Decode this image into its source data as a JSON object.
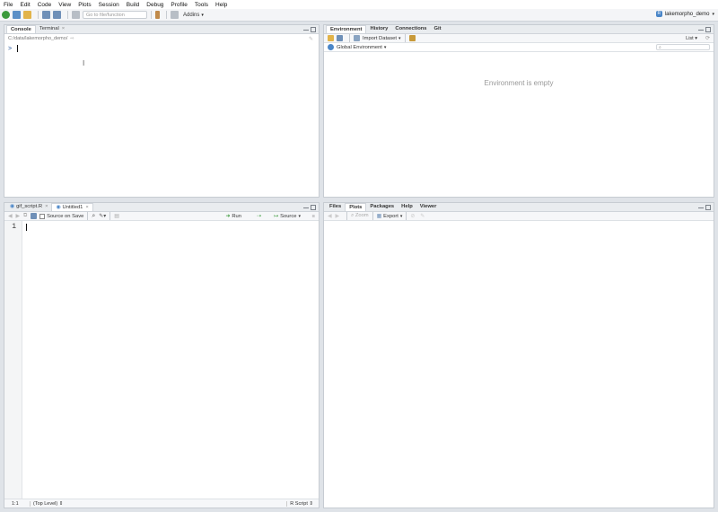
{
  "menu": [
    "File",
    "Edit",
    "Code",
    "View",
    "Plots",
    "Session",
    "Build",
    "Debug",
    "Profile",
    "Tools",
    "Help"
  ],
  "toolbar": {
    "goto_placeholder": "Go to file/function",
    "addins": "Addins"
  },
  "project": {
    "name": "lakemorpho_demo"
  },
  "console": {
    "tabs": [
      "Console",
      "Terminal"
    ],
    "terminal_close": "×",
    "path": "C:/data/lakemorpho_demo/",
    "prompt": ">"
  },
  "environment": {
    "tabs": [
      "Environment",
      "History",
      "Connections",
      "Git"
    ],
    "import_dataset": "Import Dataset",
    "list_label": "List",
    "scope": "Global Environment",
    "empty_message": "Environment is empty"
  },
  "editor": {
    "tabs": [
      {
        "label": "gif_script.R",
        "close": "×"
      },
      {
        "label": "Untitled1",
        "close": "×"
      }
    ],
    "source_on_save": "Source on Save",
    "run": "Run",
    "source": "Source",
    "line_number": "1",
    "status_position": "1:1",
    "status_scope": "(Top Level)",
    "status_type": "R Script"
  },
  "files": {
    "tabs": [
      "Files",
      "Plots",
      "Packages",
      "Help",
      "Viewer"
    ],
    "zoom": "Zoom",
    "export": "Export"
  },
  "colors": {
    "accent": "#4a86c8",
    "pane_bg": "#ffffff",
    "chrome": "#dfe3e8"
  }
}
